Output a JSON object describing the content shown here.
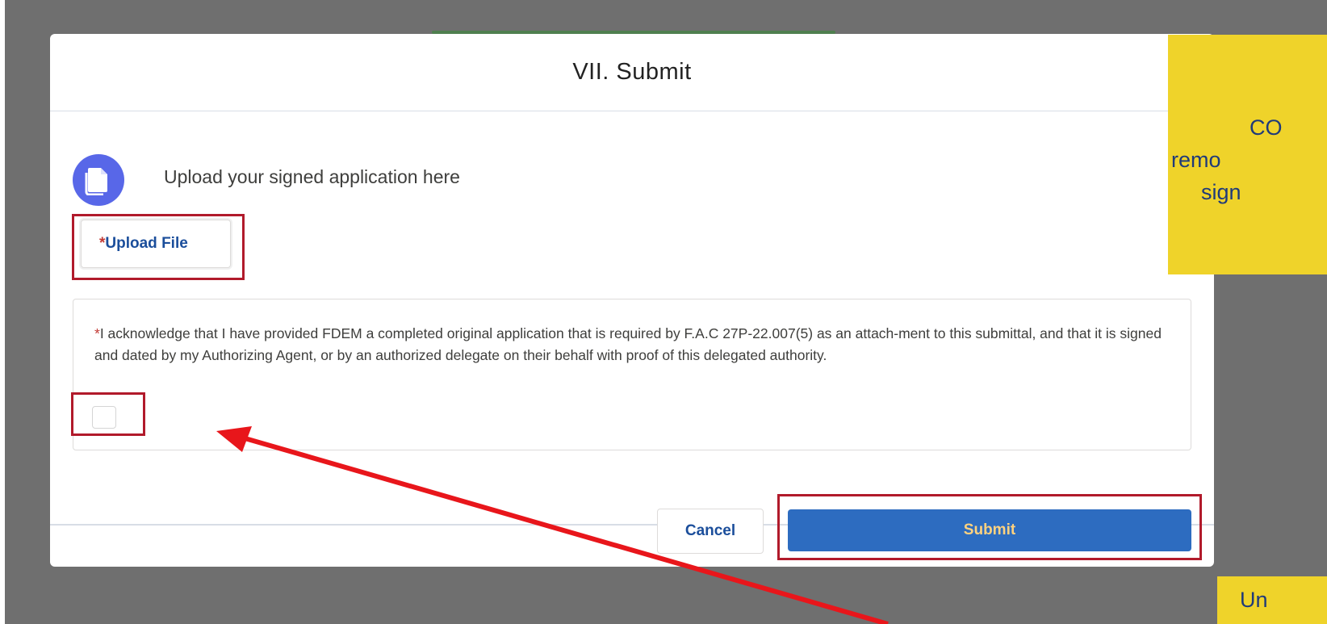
{
  "modal": {
    "title": "VII. Submit",
    "upload_heading": "Upload your signed application here",
    "upload_button": {
      "required_mark": "*",
      "label": "Upload File"
    },
    "acknowledgement": {
      "required_mark": "*",
      "text": "I acknowledge that I have provided FDEM a completed original application that is required by F.A.C 27P-22.007(5) as an attach-ment to this submittal, and that it is signed and dated by my Authorizing Agent, or by an authorized delegate on their behalf with proof of this delegated authority.",
      "checked": false
    },
    "footer": {
      "cancel_label": "Cancel",
      "submit_label": "Submit"
    }
  },
  "annotations": {
    "note_top_right": {
      "lines": [
        "CO",
        "remo",
        "sign"
      ]
    },
    "note_bottom_right": {
      "text": "Un"
    },
    "highlight_color": "#b11a2b",
    "arrow_color": "#e8161b",
    "note_color": "#efd32a"
  },
  "icons": {
    "upload": "document-copy-icon"
  }
}
